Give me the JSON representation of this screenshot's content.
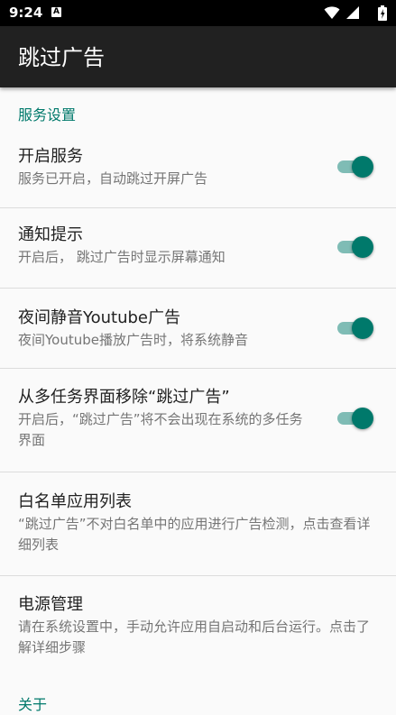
{
  "status_bar": {
    "time": "9:24",
    "notification_icon": "A"
  },
  "app_bar": {
    "title": "跳过广告"
  },
  "category": {
    "title": "服务设置"
  },
  "prefs": [
    {
      "title": "开启服务",
      "summary": "服务已开启，自动跳过开屏广告",
      "switch_on": true
    },
    {
      "title": "通知提示",
      "summary": "开启后， 跳过广告时显示屏幕通知",
      "switch_on": true
    },
    {
      "title": "夜间静音Youtube广告",
      "summary": "夜间Youtube播放广告时，将系统静音",
      "switch_on": true
    },
    {
      "title": "从多任务界面移除“跳过广告”",
      "summary": "开启后，“跳过广告”将不会出现在系统的多任务界面",
      "switch_on": true
    },
    {
      "title": "白名单应用列表",
      "summary": "“跳过广告”不对白名单中的应用进行广告检测，点击查看详细列表"
    },
    {
      "title": "电源管理",
      "summary": "请在系统设置中，手动允许应用自启动和后台运行。点击了解详细步骤"
    }
  ],
  "next_category": {
    "title": "关于"
  },
  "colors": {
    "accent": "#00796b",
    "app_bar": "#212121",
    "background": "#fafafa"
  }
}
